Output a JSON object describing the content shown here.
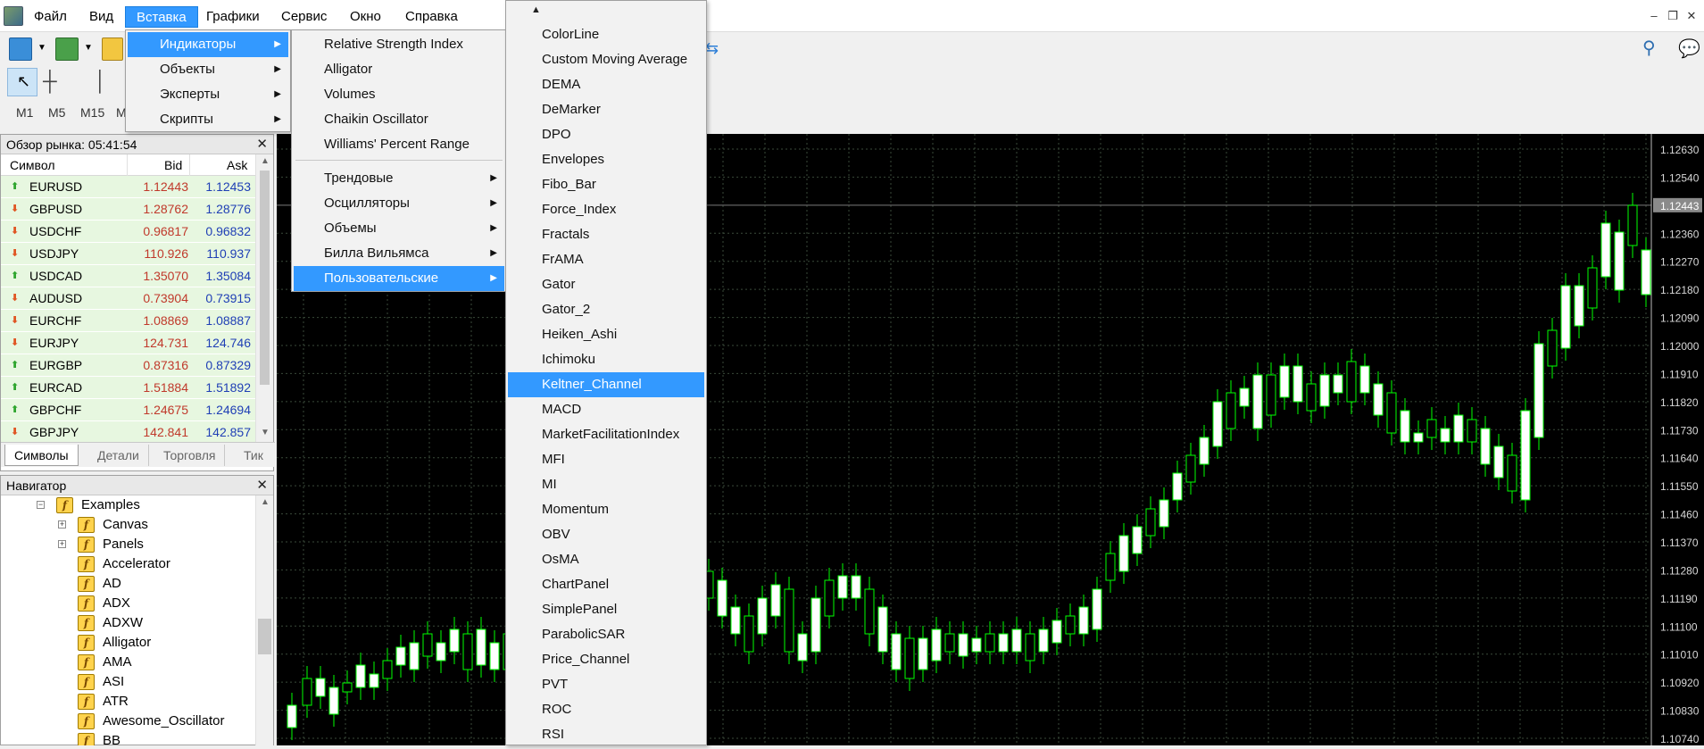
{
  "menubar": {
    "items": [
      "Файл",
      "Вид",
      "Вставка",
      "Графики",
      "Сервис",
      "Окно",
      "Справка"
    ],
    "active": "Вставка"
  },
  "timeframes": [
    "M1",
    "M5",
    "M15",
    "M"
  ],
  "market_watch": {
    "title": "Обзор рынка: 05:41:54",
    "columns": [
      "Символ",
      "Bid",
      "Ask"
    ],
    "rows": [
      {
        "symbol": "EURUSD",
        "bid": "1.12443",
        "ask": "1.12453",
        "dir": "up"
      },
      {
        "symbol": "GBPUSD",
        "bid": "1.28762",
        "ask": "1.28776",
        "dir": "down"
      },
      {
        "symbol": "USDCHF",
        "bid": "0.96817",
        "ask": "0.96832",
        "dir": "down"
      },
      {
        "symbol": "USDJPY",
        "bid": "110.926",
        "ask": "110.937",
        "dir": "down"
      },
      {
        "symbol": "USDCAD",
        "bid": "1.35070",
        "ask": "1.35084",
        "dir": "up"
      },
      {
        "symbol": "AUDUSD",
        "bid": "0.73904",
        "ask": "0.73915",
        "dir": "down"
      },
      {
        "symbol": "EURCHF",
        "bid": "1.08869",
        "ask": "1.08887",
        "dir": "down"
      },
      {
        "symbol": "EURJPY",
        "bid": "124.731",
        "ask": "124.746",
        "dir": "down"
      },
      {
        "symbol": "EURGBP",
        "bid": "0.87316",
        "ask": "0.87329",
        "dir": "up"
      },
      {
        "symbol": "EURCAD",
        "bid": "1.51884",
        "ask": "1.51892",
        "dir": "up"
      },
      {
        "symbol": "GBPCHF",
        "bid": "1.24675",
        "ask": "1.24694",
        "dir": "up"
      },
      {
        "symbol": "GBPJPY",
        "bid": "142.841",
        "ask": "142.857",
        "dir": "down"
      }
    ],
    "tabs": [
      "Символы",
      "Детали",
      "Торговля",
      "Тик"
    ]
  },
  "navigator": {
    "title": "Навигатор",
    "items": [
      "Examples",
      "Canvas",
      "Panels",
      "Accelerator",
      "AD",
      "ADX",
      "ADXW",
      "Alligator",
      "AMA",
      "ASI",
      "ATR",
      "Awesome_Oscillator",
      "BB"
    ]
  },
  "insert_menu": {
    "items": [
      "Индикаторы",
      "Объекты",
      "Эксперты",
      "Скрипты"
    ],
    "highlighted": "Индикаторы"
  },
  "indicators_menu": {
    "recent": [
      "Relative Strength Index",
      "Alligator",
      "Volumes",
      "Chaikin Oscillator",
      "Williams' Percent Range"
    ],
    "groups": [
      "Трендовые",
      "Осцилляторы",
      "Объемы",
      "Билла Вильямса",
      "Пользовательские"
    ],
    "highlighted": "Пользовательские"
  },
  "custom_menu": {
    "items": [
      "ColorLine",
      "Custom Moving Average",
      "DEMA",
      "DeMarker",
      "DPO",
      "Envelopes",
      "Fibo_Bar",
      "Force_Index",
      "Fractals",
      "FrAMA",
      "Gator",
      "Gator_2",
      "Heiken_Ashi",
      "Ichimoku",
      "Keltner_Channel",
      "MACD",
      "MarketFacilitationIndex",
      "MFI",
      "MI",
      "Momentum",
      "OBV",
      "OsMA",
      "ChartPanel",
      "SimplePanel",
      "ParabolicSAR",
      "Price_Channel",
      "PVT",
      "ROC",
      "RSI"
    ],
    "highlighted": "Keltner_Channel"
  },
  "chart": {
    "price_labels": [
      "1.12630",
      "1.12540",
      "1.12443",
      "1.12360",
      "1.12270",
      "1.12180",
      "1.12090",
      "1.12000",
      "1.11910",
      "1.11820",
      "1.11730",
      "1.11640",
      "1.11550",
      "1.11460",
      "1.11370",
      "1.11280",
      "1.11190",
      "1.11100",
      "1.11010",
      "1.10920",
      "1.10830",
      "1.10740"
    ],
    "current_price": "1.12443",
    "colors": {
      "bull": "#ffffff",
      "bear": "#000000",
      "wick": "#00ff00",
      "grid": "#3a4a3a",
      "background": "#000000"
    }
  }
}
